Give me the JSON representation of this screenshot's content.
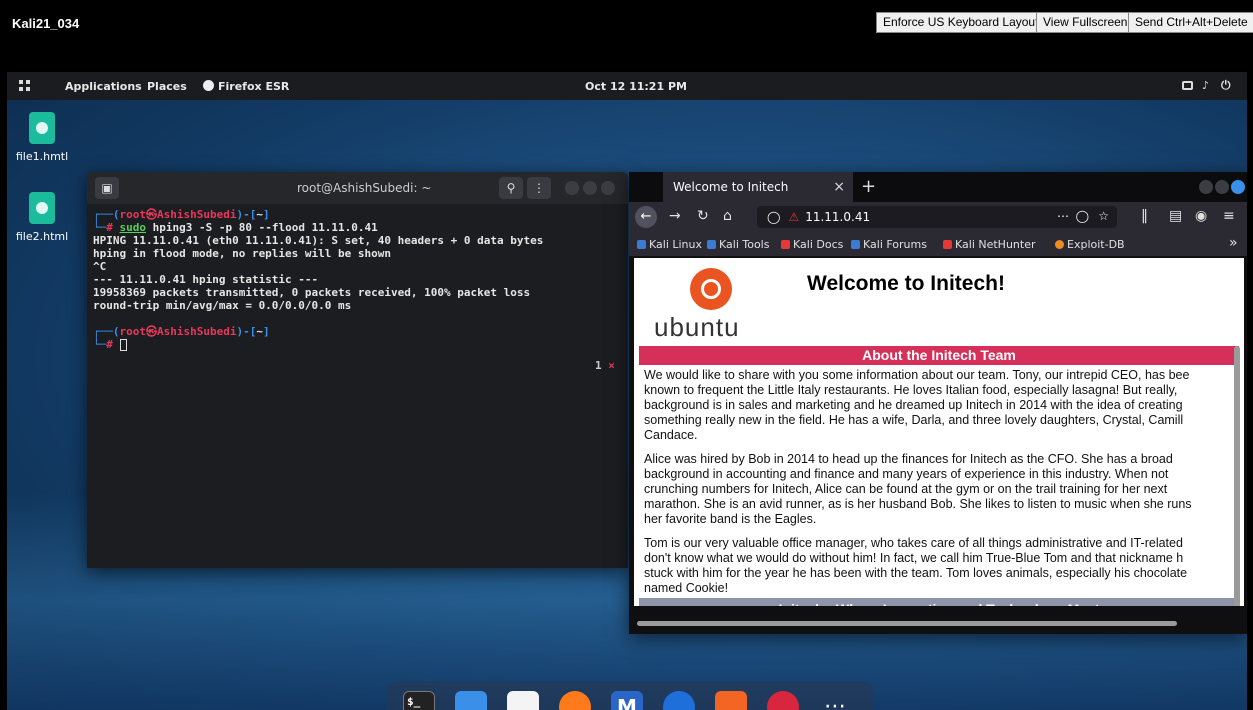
{
  "vnc": {
    "title": "Kali21_034",
    "buttons": [
      "Enforce US Keyboard Layout",
      "View Fullscreen",
      "Send Ctrl+Alt+Delete"
    ]
  },
  "panel": {
    "menu_applications": "Applications",
    "menu_places": "Places",
    "active_app": "Firefox ESR",
    "clock": "Oct 12  11:21 PM"
  },
  "desktop_files": [
    "file1.hmtl",
    "file2.html"
  ],
  "terminal": {
    "title": "root@AshishSubedi: ~",
    "tab_badge_count": "1",
    "tab_badge_close": "×",
    "prompt_user": "root",
    "prompt_host": "AshishSubedi",
    "prompt_dir": "~",
    "command_sudo": "sudo",
    "command_rest": "hping3 -S -p 80 --flood 11.11.0.41",
    "output": [
      "HPING 11.11.0.41 (eth0 11.11.0.41): S set, 40 headers + 0 data bytes",
      "hping in flood mode, no replies will be shown",
      "^C",
      "--- 11.11.0.41 hping statistic ---",
      "19958369 packets transmitted, 0 packets received, 100% packet loss",
      "round-trip min/avg/max = 0.0/0.0/0.0 ms"
    ]
  },
  "firefox": {
    "tab_title": "Welcome to Initech",
    "url": "11.11.0.41",
    "bookmarks": [
      {
        "label": "Kali Linux",
        "color": "#3b7bd4"
      },
      {
        "label": "Kali Tools",
        "color": "#3b7bd4"
      },
      {
        "label": "Kali Docs",
        "color": "#e53935"
      },
      {
        "label": "Kali Forums",
        "color": "#3b7bd4"
      },
      {
        "label": "Kali NetHunter",
        "color": "#e53935"
      },
      {
        "label": "Exploit-DB",
        "color": "#f08a24"
      }
    ],
    "bookmarks_overflow": "»"
  },
  "webpage": {
    "heading": "Welcome to Initech!",
    "logo_text": "ubuntu",
    "section_title": "About the Initech Team",
    "paragraph1": [
      "We would like to share with you some information about our team. Tony, our intrepid CEO, has bee",
      "known to frequent the Little Italy restaurants. He loves Italian food, especially lasagna! But really,",
      "background is in sales and marketing and he dreamed up Initech in 2014 with the idea of creating",
      "something really new in the field. He has a wife, Darla, and three lovely daughters, Crystal, Camill",
      "Candace."
    ],
    "paragraph2": [
      "Alice was hired by Bob in 2014 to head up the finances for Initech as the CFO. She has a broad",
      "background in accounting and finance and many years of experience in this industry. When not",
      "crunching numbers for Initech, Alice can be found at the gym or on the trail training for her next",
      "marathon. She is an avid runner, as is her husband Bob. She likes to listen to music when she runs",
      "her favorite band is the Eagles."
    ],
    "paragraph3": [
      "Tom is our very valuable office manager, who takes care of all things administrative and IT-related",
      "don't know what we would do without him! In fact, we call him True-Blue Tom and that nickname h",
      "stuck with him for the year he has been with the team. Tom loves animals, especially his chocolate",
      "named Cookie!"
    ],
    "footer_title": "Initech - Where Innovation and Technology Meet"
  },
  "dock": {
    "items": [
      {
        "icon": "terminal-icon",
        "color": "#222"
      },
      {
        "icon": "files-icon",
        "color": "#3a8fe8"
      },
      {
        "icon": "text-editor-icon",
        "color": "#f4f4f4"
      },
      {
        "icon": "firefox-icon",
        "color": "#ff7a1a"
      },
      {
        "icon": "metasploit-icon",
        "color": "#2a66c8"
      },
      {
        "icon": "wireshark-icon",
        "color": "#1e6fd9"
      },
      {
        "icon": "burpsuite-icon",
        "color": "#f26522"
      },
      {
        "icon": "cherrytree-icon",
        "color": "#d7263d"
      },
      {
        "icon": "show-apps-icon",
        "color": "transparent"
      }
    ]
  }
}
